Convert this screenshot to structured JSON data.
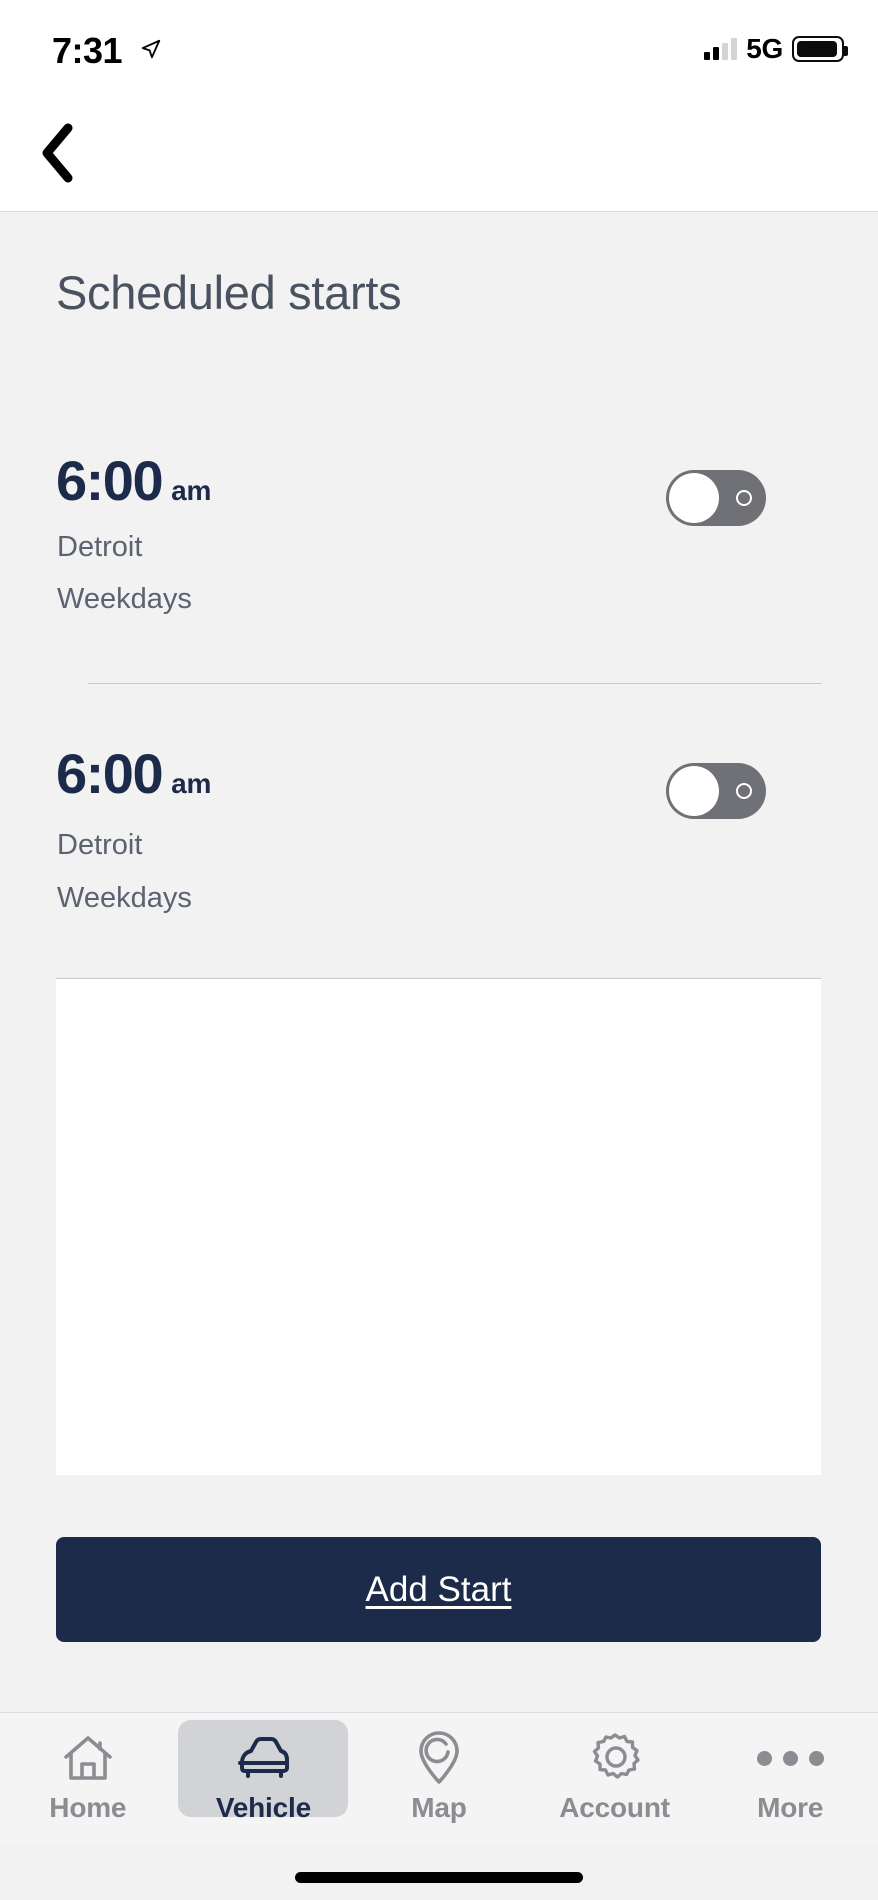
{
  "status_bar": {
    "time": "7:31",
    "location_icon": "location-arrow-icon",
    "network": "5G",
    "signal_bars_filled": 2,
    "signal_bars_total": 4,
    "battery_icon": "battery-full-icon"
  },
  "nav": {
    "back_icon": "chevron-left-icon"
  },
  "page": {
    "title": "Scheduled starts"
  },
  "schedules": [
    {
      "time": "6:00",
      "meridiem": "am",
      "location": "Detroit",
      "days": "Weekdays",
      "toggle_state": "off",
      "toggle_name": "schedule-toggle-1"
    },
    {
      "time": "6:00",
      "meridiem": "am",
      "location": "Detroit",
      "days": "Weekdays",
      "toggle_state": "off",
      "toggle_name": "schedule-toggle-2"
    }
  ],
  "primary_action": {
    "label": "Add Start"
  },
  "tabbar": {
    "active": "Vehicle",
    "items": [
      {
        "label": "Home",
        "icon": "house-icon",
        "active": false
      },
      {
        "label": "Vehicle",
        "icon": "car-icon",
        "active": true
      },
      {
        "label": "Map",
        "icon": "map-pin-icon",
        "active": false
      },
      {
        "label": "Account",
        "icon": "gear-icon",
        "active": false
      },
      {
        "label": "More",
        "icon": "ellipsis-icon",
        "active": false
      }
    ]
  },
  "colors": {
    "navy": "#1d2b4b",
    "page_background": "#f2f2f2",
    "title_gray": "#4a5160",
    "subtext_gray": "#5b6270",
    "toggle_track": "#6f7177",
    "tab_inactive": "#8b8d93",
    "tab_active_pill": "#d2d3d6"
  }
}
